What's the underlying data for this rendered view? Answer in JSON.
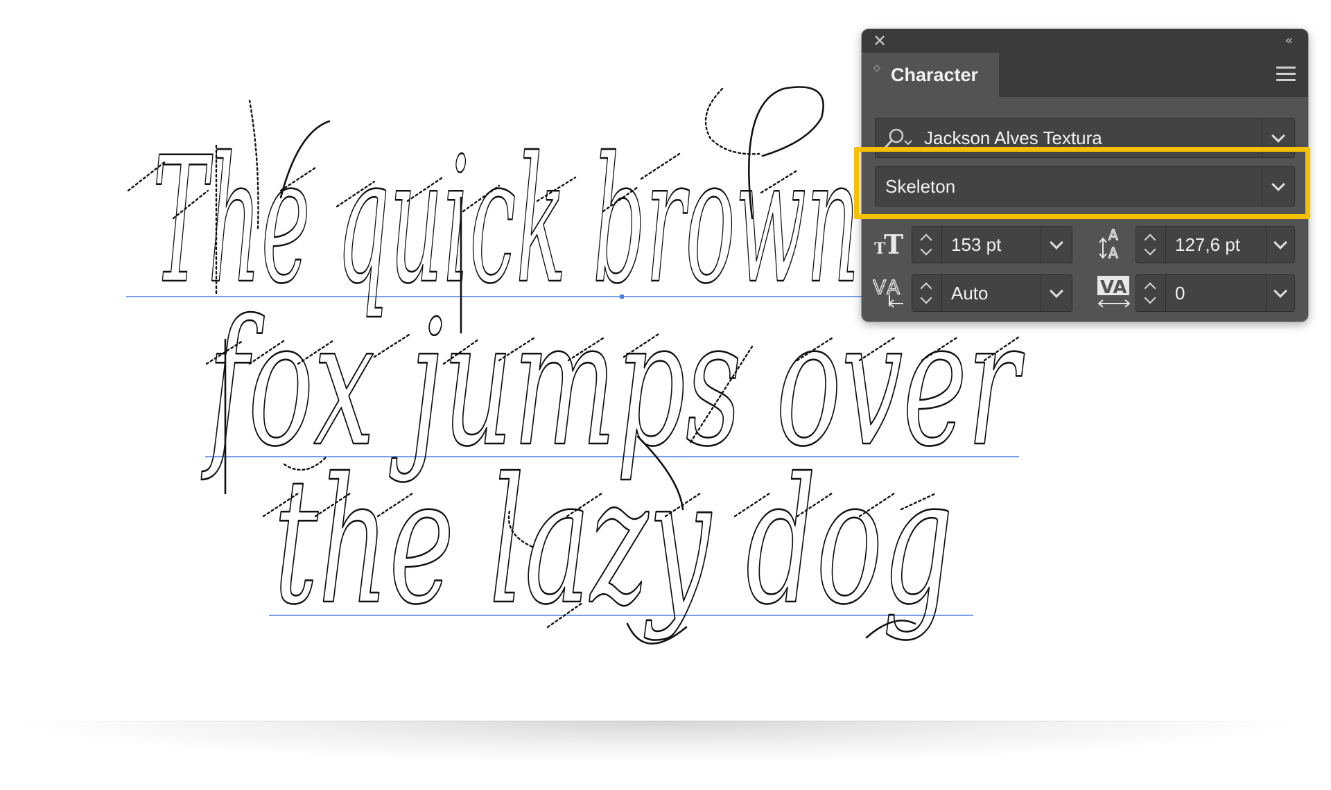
{
  "canvas": {
    "lines": [
      "The quick brown",
      "fox jumps over",
      "the lazy dog"
    ],
    "colors": {
      "ink": "#111111",
      "baseline": "#4a7fe0"
    }
  },
  "panel": {
    "title": "Character",
    "close_icon": "close-icon",
    "collapse_icon": "double-chevron-left-icon",
    "menu_icon": "hamburger-menu-icon",
    "font_family": {
      "value": "Jackson Alves Textura",
      "icon": "search-font-icon"
    },
    "font_style": {
      "value": "Skeleton",
      "highlighted": true
    },
    "font_size": {
      "value": "153 pt",
      "icon": "font-size-icon"
    },
    "leading": {
      "value": "127,6 pt",
      "icon": "leading-icon"
    },
    "kerning": {
      "value": "Auto",
      "icon": "kerning-icon"
    },
    "tracking": {
      "value": "0",
      "icon": "tracking-icon"
    },
    "colors": {
      "panel_bg": "#535353",
      "titlebar_bg": "#3b3b3b",
      "field_bg": "#434343",
      "highlight": "#f5c000"
    }
  }
}
